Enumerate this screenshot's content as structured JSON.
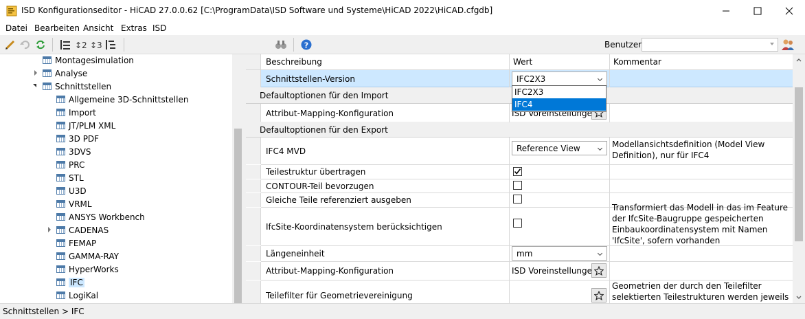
{
  "window": {
    "title": "ISD Konfigurationseditor  -  HiCAD 27.0.0.62 [C:\\ProgramData\\ISD Software und Systeme\\HiCAD 2022\\HiCAD.cfgdb]",
    "controls": {
      "minimize": "minimize-icon",
      "maximize": "maximize-icon",
      "close": "close-icon"
    }
  },
  "menu": [
    "Datei",
    "Bearbeiten",
    "Ansicht",
    "Extras",
    "ISD"
  ],
  "toolbar": {
    "icons": [
      "pencil-icon",
      "undo-icon",
      "refresh-icon",
      "level-1-icon",
      "level-2-icon",
      "level-3-icon",
      "expand-all-icon",
      "binoculars-icon",
      "help-icon"
    ],
    "benutzer_label": "Benutzer",
    "benutzer_value": "",
    "users_icon": "users-icon"
  },
  "tree": {
    "nodes": [
      {
        "label": "Montagesimulation",
        "level": 1,
        "expander": "none"
      },
      {
        "label": "Analyse",
        "level": 1,
        "expander": "collapsed"
      },
      {
        "label": "Schnittstellen",
        "level": 1,
        "expander": "expanded"
      },
      {
        "label": "Allgemeine 3D-Schnittstellen",
        "level": 2,
        "expander": "none"
      },
      {
        "label": "Import",
        "level": 2,
        "expander": "none"
      },
      {
        "label": "JT/PLM XML",
        "level": 2,
        "expander": "none"
      },
      {
        "label": "3D PDF",
        "level": 2,
        "expander": "none"
      },
      {
        "label": "3DVS",
        "level": 2,
        "expander": "none"
      },
      {
        "label": "PRC",
        "level": 2,
        "expander": "none"
      },
      {
        "label": "STL",
        "level": 2,
        "expander": "none"
      },
      {
        "label": "U3D",
        "level": 2,
        "expander": "none"
      },
      {
        "label": "VRML",
        "level": 2,
        "expander": "none"
      },
      {
        "label": "ANSYS Workbench",
        "level": 2,
        "expander": "none"
      },
      {
        "label": "CADENAS",
        "level": 2,
        "expander": "collapsed"
      },
      {
        "label": "FEMAP",
        "level": 2,
        "expander": "none"
      },
      {
        "label": "GAMMA-RAY",
        "level": 2,
        "expander": "none"
      },
      {
        "label": "HyperWorks",
        "level": 2,
        "expander": "none"
      },
      {
        "label": "IFC",
        "level": 2,
        "expander": "none",
        "selected": true
      },
      {
        "label": "LogiKal",
        "level": 2,
        "expander": "none"
      }
    ]
  },
  "grid": {
    "headers": {
      "beschreibung": "Beschreibung",
      "wert": "Wert",
      "kommentar": "Kommentar"
    },
    "row_version": {
      "label": "Schnittstellen-Version",
      "value": "IFC2X3"
    },
    "dropdown_options": [
      "IFC2X3",
      "IFC4"
    ],
    "dropdown_highlighted": "IFC4",
    "group_import": "Defaultoptionen für den Import",
    "row_import_mapping": {
      "label": "Attribut-Mapping-Konfiguration",
      "value": "ISD Voreinstellungen"
    },
    "group_export": "Defaultoptionen für den Export",
    "row_mvd": {
      "label": "IFC4 MVD",
      "value": "Reference View",
      "comment": "Modellansichtsdefinition (Model View Definition), nur für IFC4"
    },
    "row_teilestruktur": {
      "label": "Teilestruktur übertragen",
      "checked": true
    },
    "row_contour": {
      "label": "CONTOUR-Teil bevorzugen",
      "checked": false
    },
    "row_gleiche": {
      "label": "Gleiche Teile referenziert ausgeben",
      "checked": false
    },
    "row_ifcsite": {
      "label": "IfcSite-Koordinatensystem berücksichtigen",
      "checked": false,
      "comment": "Transformiert das Modell in das im Feature der IfcSite-Baugruppe gespeicherten Einbaukoordinatensystem mit Namen 'IfcSite', sofern vorhanden"
    },
    "row_laenge": {
      "label": "Längeneinheit",
      "value": "mm"
    },
    "row_export_mapping": {
      "label": "Attribut-Mapping-Konfiguration",
      "value": "ISD Voreinstellungen"
    },
    "row_teilefilter": {
      "label": "Teilefilter für Geometrievereinigung",
      "comment": "Geometrien der durch den Teilefilter selektierten Teilestrukturen werden jeweils zu einem"
    }
  },
  "status": {
    "path": "Schnittstellen > IFC"
  }
}
